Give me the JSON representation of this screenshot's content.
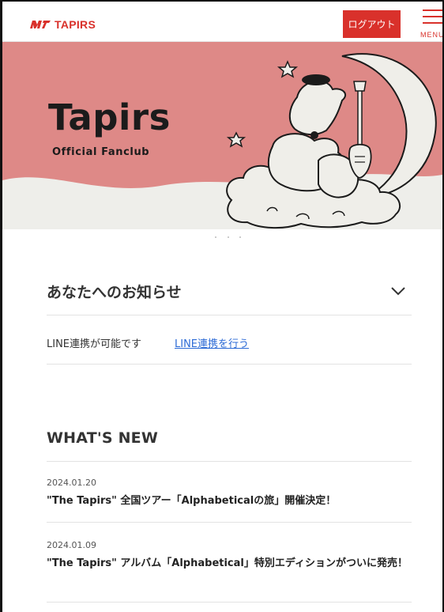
{
  "header": {
    "logo_text": "TAPIRS",
    "logout_label": "ログアウト",
    "menu_label": "MENU"
  },
  "hero": {
    "title": "Tapirs",
    "subtitle": "Official Fanclub"
  },
  "notice": {
    "title": "あなたへのお知らせ",
    "line_text": "LINE連携が可能です",
    "line_link": "LINE連携を行う"
  },
  "news": {
    "title": "WHAT'S NEW",
    "items": [
      {
        "date": "2024.01.20",
        "headline": "\"The Tapirs\" 全国ツアー「Alphabeticalの旅」開催決定！"
      },
      {
        "date": "2024.01.09",
        "headline": "\"The Tapirs\" アルバム「Alphabetical」特別エディションがついに発売！"
      }
    ]
  },
  "colors": {
    "brand_red": "#d9312b",
    "hero_pink": "#de8987",
    "link_blue": "#2d6bd6"
  }
}
